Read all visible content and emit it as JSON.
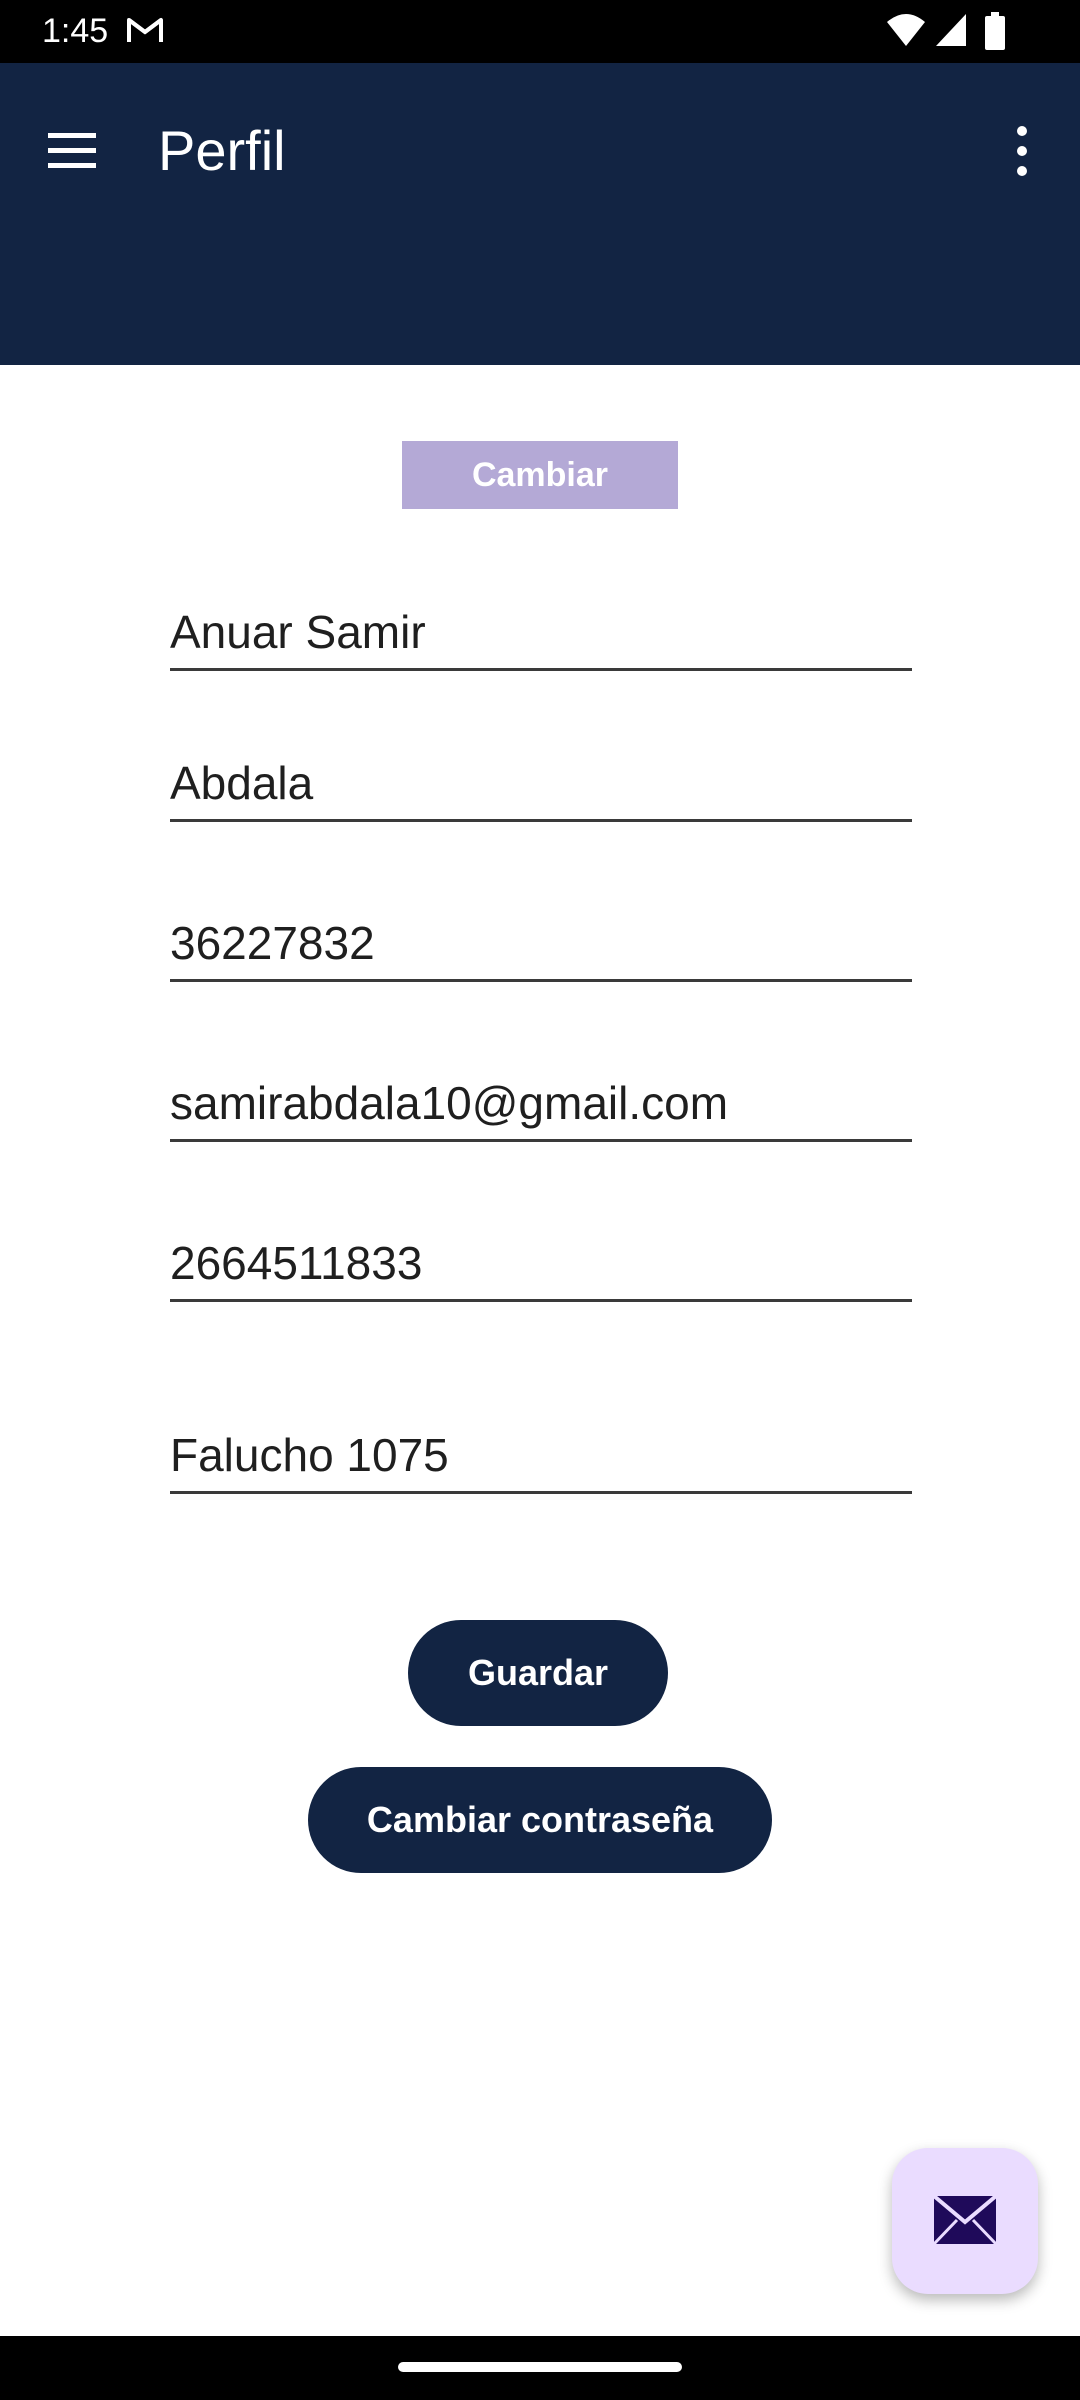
{
  "status_bar": {
    "time": "1:45",
    "icons": [
      "gmail-icon",
      "wifi-icon",
      "signal-icon",
      "battery-icon"
    ]
  },
  "app_bar": {
    "title": "Perfil",
    "background_color": "#122443",
    "menu_icon": "hamburger-menu-icon",
    "more_icon": "more-vertical-icon"
  },
  "profile": {
    "change_photo_label": "Cambiar",
    "fields": [
      {
        "name": "first-name",
        "value": "Anuar Samir"
      },
      {
        "name": "last-name",
        "value": "Abdala"
      },
      {
        "name": "dni",
        "value": "36227832"
      },
      {
        "name": "email",
        "value": "samirabdala10@gmail.com"
      },
      {
        "name": "phone",
        "value": "2664511833"
      },
      {
        "name": "address",
        "value": "Falucho 1075"
      }
    ]
  },
  "actions": {
    "save_label": "Guardar",
    "change_password_label": "Cambiar contraseña"
  },
  "fab": {
    "icon": "mail-icon",
    "background_color": "#eadcff"
  }
}
